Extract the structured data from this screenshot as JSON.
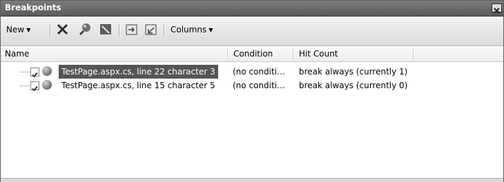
{
  "window": {
    "title": "Breakpoints",
    "close_symbol": "✕"
  },
  "toolbar": {
    "new_label": "New",
    "columns_label": "Columns",
    "icons": [
      "delete-icon",
      "delete-all-icon",
      "disable-all-icon",
      "export-icon",
      "import-icon"
    ]
  },
  "columns": {
    "name": "Name",
    "condition": "Condition",
    "hit_count": "Hit Count"
  },
  "breakpoints": [
    {
      "checked": true,
      "name": "TestPage.aspx.cs, line 22 character 3",
      "condition": "(no conditi…",
      "hit_count": "break always (currently 1)",
      "selected": true
    },
    {
      "checked": true,
      "name": "TestPage.aspx.cs, line 15 character 5",
      "condition": "(no conditi…",
      "hit_count": "break always (currently 0)",
      "selected": false
    }
  ],
  "colors": {
    "selection": "#555555",
    "titlebar": "#6a6a6a"
  }
}
